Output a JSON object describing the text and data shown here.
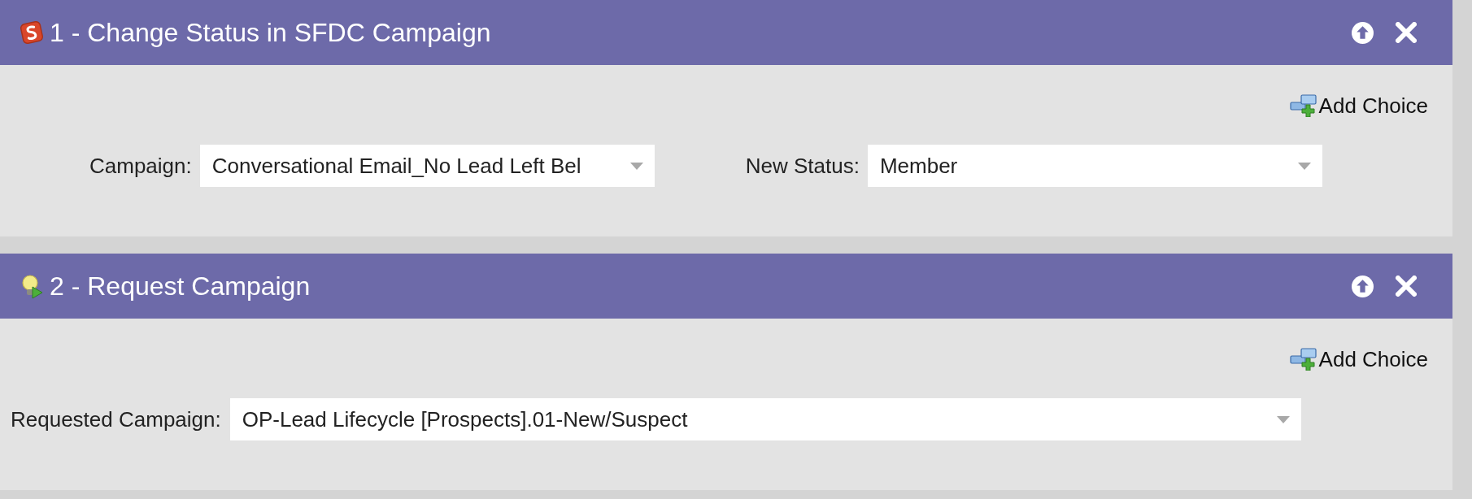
{
  "steps": [
    {
      "kind": "salesforce",
      "title": "1 - Change Status in SFDC Campaign",
      "add_choice": "Add Choice",
      "fields": [
        {
          "label": "Campaign:",
          "value": "Conversational Email_No Lead Left Bel"
        },
        {
          "label": "New Status:",
          "value": "Member"
        }
      ]
    },
    {
      "kind": "request",
      "title": "2 - Request Campaign",
      "add_choice": "Add Choice",
      "fields": [
        {
          "label": "Requested Campaign:",
          "value": "OP-Lead Lifecycle [Prospects].01-New/Suspect"
        }
      ]
    }
  ]
}
